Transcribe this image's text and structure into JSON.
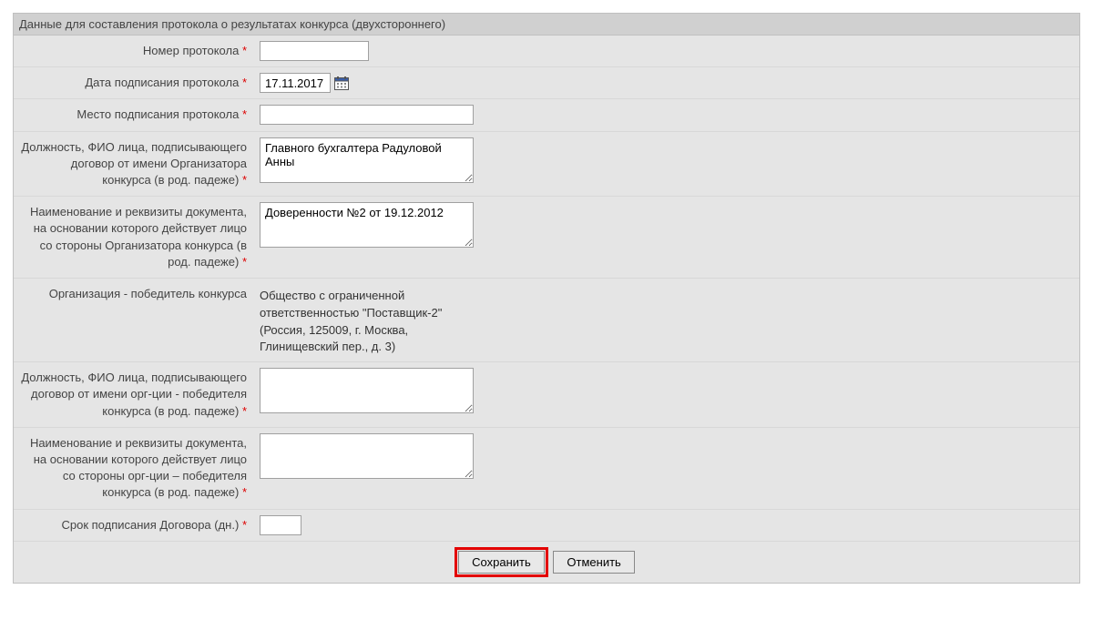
{
  "header": {
    "title": "Данные для составления протокола о результатах конкурса (двухстороннего)"
  },
  "fields": {
    "protocol_number": {
      "label": "Номер протокола",
      "value": ""
    },
    "signing_date": {
      "label": "Дата подписания протокола",
      "value": "17.11.2017"
    },
    "signing_place": {
      "label": "Место подписания протокола",
      "value": ""
    },
    "organizer_signer": {
      "label": "Должность, ФИО лица, подписывающего договор от имени Организатора конкурса (в род. падеже)",
      "value": "Главного бухгалтера Радуловой Анны"
    },
    "organizer_doc": {
      "label": "Наименование и реквизиты документа, на основании которого действует лицо со стороны Организатора конкурса (в род. падеже)",
      "value": "Доверенности №2 от 19.12.2012"
    },
    "winner_org": {
      "label": "Организация - победитель конкурса",
      "value": "Общество с ограниченной ответственностью \"Поставщик-2\" (Россия, 125009, г. Москва, Глинищевский пер., д. 3)"
    },
    "winner_signer": {
      "label": "Должность, ФИО лица, подписывающего договор от имени орг-ции - победителя конкурса (в род. падеже)",
      "value": ""
    },
    "winner_doc": {
      "label": "Наименование и реквизиты документа, на основании которого действует лицо со стороны орг-ции – победителя конкурса (в род. падеже)",
      "value": ""
    },
    "signing_term": {
      "label": "Срок подписания Договора (дн.)",
      "value": ""
    }
  },
  "buttons": {
    "save": "Сохранить",
    "cancel": "Отменить"
  }
}
